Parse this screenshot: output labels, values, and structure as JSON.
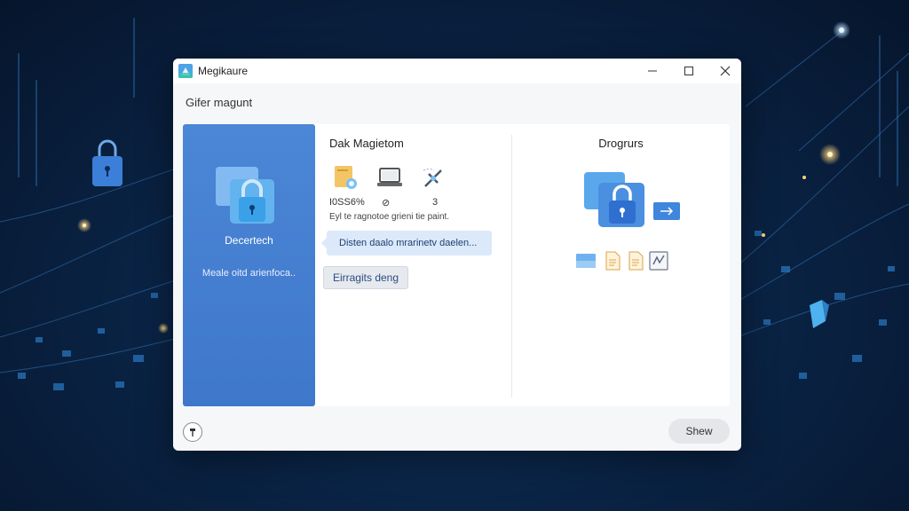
{
  "window": {
    "title": "Megikaure",
    "subtitle": "Gifer magunt"
  },
  "left_panel": {
    "title": "Decertech",
    "description": "Meale oitd arienfoca.."
  },
  "middle_panel": {
    "title": "Dak Magietom",
    "stats": [
      {
        "icon": "document-lock-icon",
        "value": "I0SS6%"
      },
      {
        "icon": "laptop-icon",
        "value": "⊘"
      },
      {
        "icon": "satellite-icon",
        "value": "3"
      }
    ],
    "description": "Eyl te ragnotoe grieni tie paint.",
    "info_text": "Disten daalo mrarinetv daelen...",
    "button_label": "Eirragits deng"
  },
  "right_panel": {
    "title": "Drogrurs",
    "files": [
      "image-file-icon",
      "document-icon",
      "document-icon",
      "chart-file-icon"
    ]
  },
  "footer": {
    "show_label": "Shew"
  },
  "colors": {
    "accent": "#3f78cb",
    "info_bg": "#dbe9fb",
    "background": "#0a2446"
  }
}
